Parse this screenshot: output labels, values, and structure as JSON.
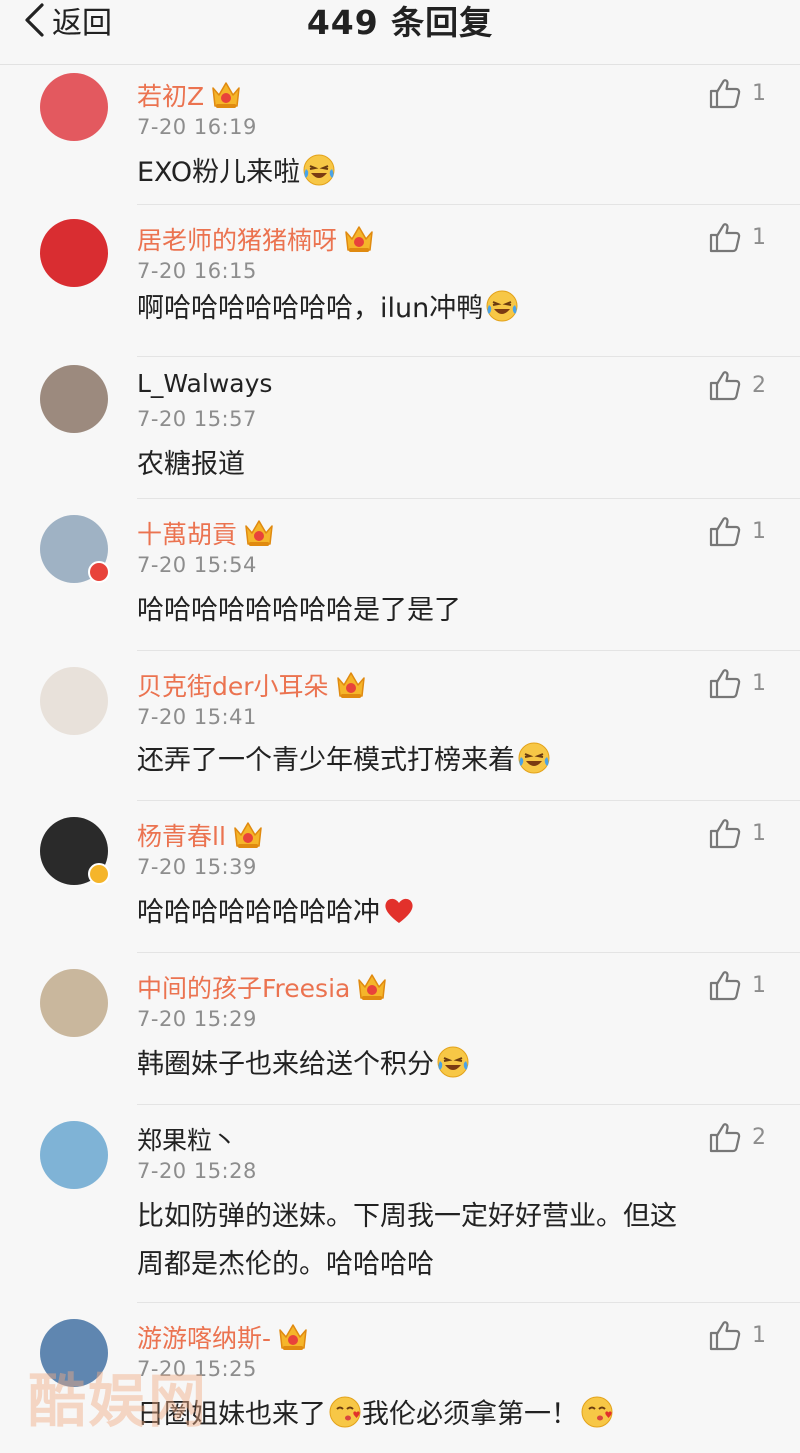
{
  "nav": {
    "back_label": "返回",
    "title": "449 条回复"
  },
  "comments": [
    {
      "name": "若初Z",
      "time": "7-20 16:19",
      "text": "EXO粉儿来啦",
      "emoji": "laughing-tears-emoji",
      "likes": "1",
      "vip": true,
      "avatar_color": "#e3595f"
    },
    {
      "name": "居老师的猪猪楠呀",
      "time": "7-20 16:15",
      "text": "啊哈哈哈哈哈哈哈，ilun冲鸭",
      "emoji": "laughing-tears-emoji",
      "likes": "1",
      "vip": true,
      "avatar_color": "#d92d31"
    },
    {
      "name": "L_Walways",
      "time": "7-20 15:57",
      "text": "农糖报道",
      "emoji": "",
      "likes": "2",
      "vip": false,
      "avatar_color": "#9c8a7e"
    },
    {
      "name": "十萬胡貢",
      "time": "7-20 15:54",
      "text": "哈哈哈哈哈哈哈哈是了是了",
      "emoji": "",
      "likes": "1",
      "vip": true,
      "avatar_color": "#9fb2c4"
    },
    {
      "name": "贝克街der小耳朵",
      "time": "7-20 15:41",
      "text": "还弄了一个青少年模式打榜来着",
      "emoji": "laughing-tears-emoji",
      "likes": "1",
      "vip": true,
      "avatar_color": "#e8e1da"
    },
    {
      "name": "杨青春ll",
      "time": "7-20 15:39",
      "text": "哈哈哈哈哈哈哈哈冲",
      "emoji": "red-heart-emoji",
      "likes": "1",
      "vip": true,
      "avatar_color": "#2a2a2a"
    },
    {
      "name": "中间的孩子Freesia",
      "time": "7-20 15:29",
      "text": "韩圈妹子也来给送个积分",
      "emoji": "laughing-tears-emoji",
      "likes": "1",
      "vip": true,
      "avatar_color": "#c9b79d"
    },
    {
      "name": "郑果粒丶",
      "time": "7-20 15:28",
      "text": "比如防弹的迷妹。下周我一定好好营业。但这\n周都是杰伦的。哈哈哈哈",
      "emoji": "",
      "likes": "2",
      "vip": false,
      "avatar_color": "#7fb3d6"
    },
    {
      "name": "游游喀纳斯-",
      "time": "7-20 15:25",
      "text": "日圈姐妹也来了",
      "text_2": "我伦必须拿第一！",
      "emoji": "kiss-emoji",
      "likes": "1",
      "vip": true,
      "avatar_color": "#5f86b0"
    }
  ],
  "colors": {
    "vip_name": "#eb7350",
    "time": "#8d8d8d",
    "divider": "#e4e4e4"
  },
  "watermark": "酷娱网"
}
